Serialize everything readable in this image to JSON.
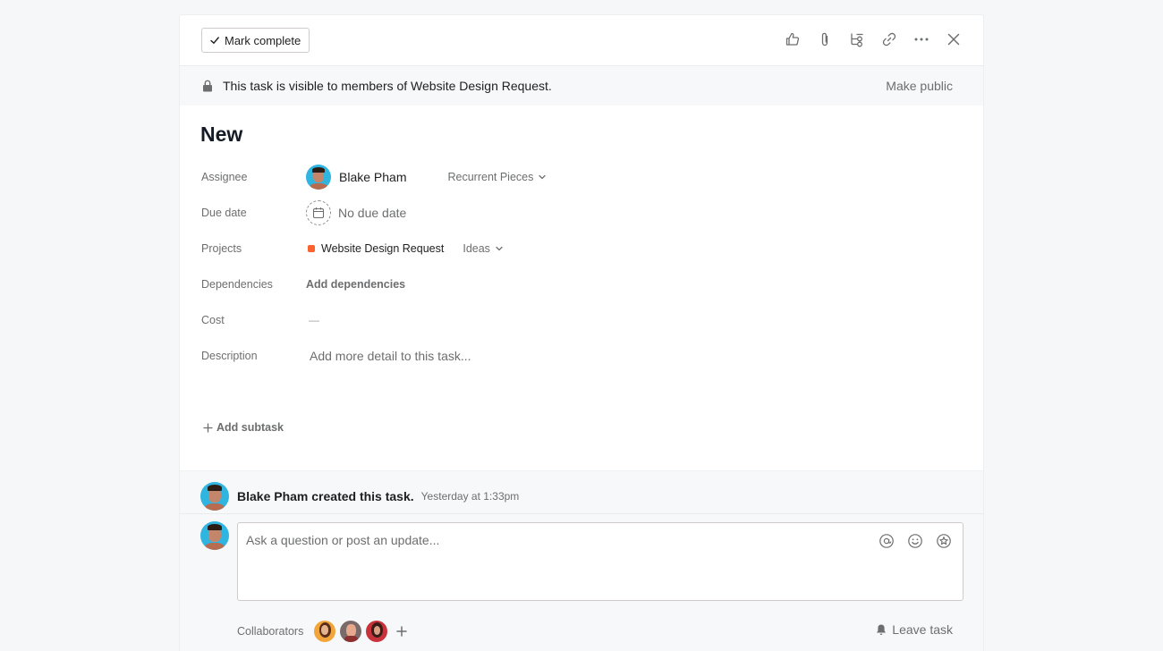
{
  "toolbar": {
    "mark_complete_label": "Mark complete",
    "icons": [
      "like-icon",
      "attachment-icon",
      "subtasks-icon",
      "link-icon",
      "more-icon",
      "close-icon"
    ]
  },
  "banner": {
    "text": "This task is visible to members of Website Design Request.",
    "action_label": "Make public"
  },
  "task": {
    "title": "New",
    "fields": {
      "assignee": {
        "label": "Assignee",
        "name": "Blake Pham",
        "workspace": "Recurrent Pieces"
      },
      "due_date": {
        "label": "Due date",
        "value": "No due date"
      },
      "projects": {
        "label": "Projects",
        "project": "Website Design Request",
        "section": "Ideas",
        "project_color": "#fd612c"
      },
      "dependencies": {
        "label": "Dependencies",
        "action": "Add dependencies"
      },
      "cost": {
        "label": "Cost",
        "value": "—"
      },
      "description": {
        "label": "Description",
        "placeholder": "Add more detail to this task..."
      }
    },
    "add_subtask_label": "Add subtask"
  },
  "feed": {
    "story": {
      "text": "Blake Pham created this task.",
      "time": "Yesterday at 1:33pm"
    },
    "composer_placeholder": "Ask a question or post an update...",
    "composer_icons": [
      "mention-icon",
      "emoji-icon",
      "appreciation-icon"
    ],
    "collaborators_label": "Collaborators",
    "leave_label": "Leave task"
  },
  "colors": {
    "accent_orange": "#fd612c",
    "avatar_blue": "#30b4e0",
    "muted_text": "#6d6e6f"
  }
}
